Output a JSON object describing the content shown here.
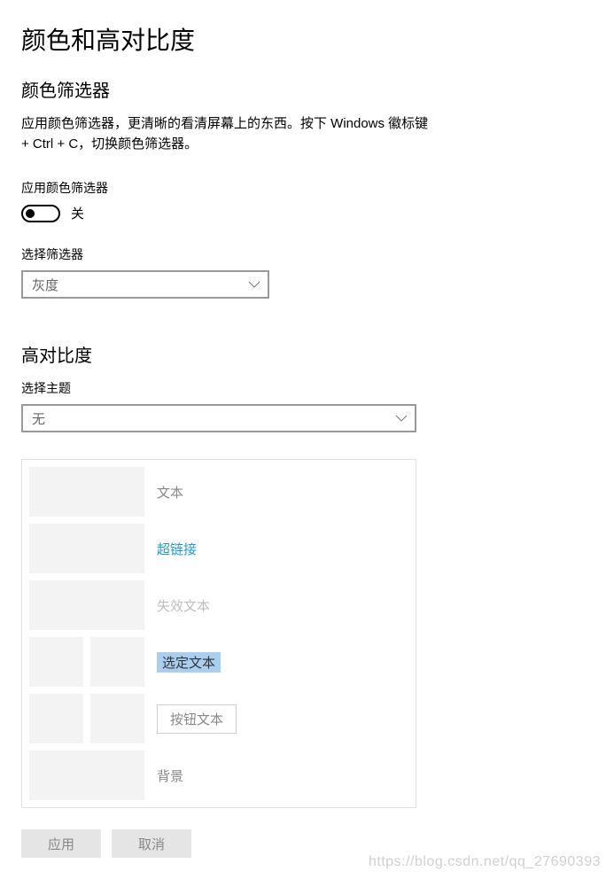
{
  "page": {
    "title": "颜色和高对比度"
  },
  "filter": {
    "section_title": "颜色筛选器",
    "description": "应用颜色筛选器，更清晰的看清屏幕上的东西。按下 Windows 徽标键 + Ctrl + C，切换颜色筛选器。",
    "toggle_label": "应用颜色筛选器",
    "toggle_state": "关",
    "select_label": "选择筛选器",
    "select_value": "灰度"
  },
  "contrast": {
    "section_title": "高对比度",
    "select_label": "选择主题",
    "select_value": "无"
  },
  "preview": {
    "text": "文本",
    "hyperlink": "超链接",
    "disabled": "失效文本",
    "selected": "选定文本",
    "button": "按钮文本",
    "background": "背景"
  },
  "actions": {
    "apply": "应用",
    "cancel": "取消"
  },
  "watermark": "https://blog.csdn.net/qq_27690393"
}
